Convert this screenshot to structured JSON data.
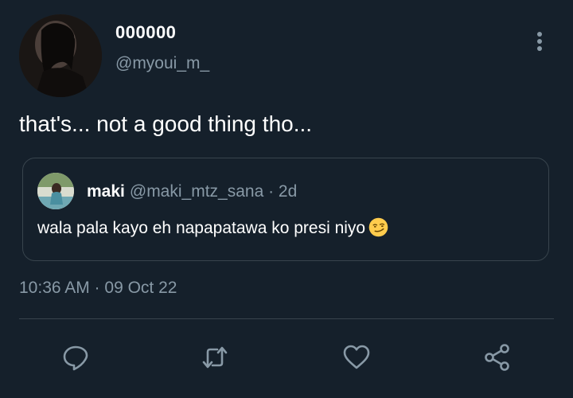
{
  "tweet": {
    "display_name": "000000",
    "handle": "@myoui_m_",
    "text": "that's... not a good thing tho...",
    "timestamp": "10:36 AM · 09 Oct 22"
  },
  "quoted_tweet": {
    "display_name": "maki",
    "handle_time": "@maki_mtz_sana · 2d",
    "text": "wala pala kayo eh napapatawa ko presi niyo",
    "emoji": "smirking-face"
  },
  "icons": {
    "more": "more-vertical-icon",
    "reply": "reply-icon",
    "retweet": "retweet-icon",
    "like": "heart-icon",
    "share": "share-icon"
  },
  "colors": {
    "background": "#15202b",
    "secondary_text": "#8899a6",
    "border": "#38444d",
    "icon": "#8899a6"
  }
}
